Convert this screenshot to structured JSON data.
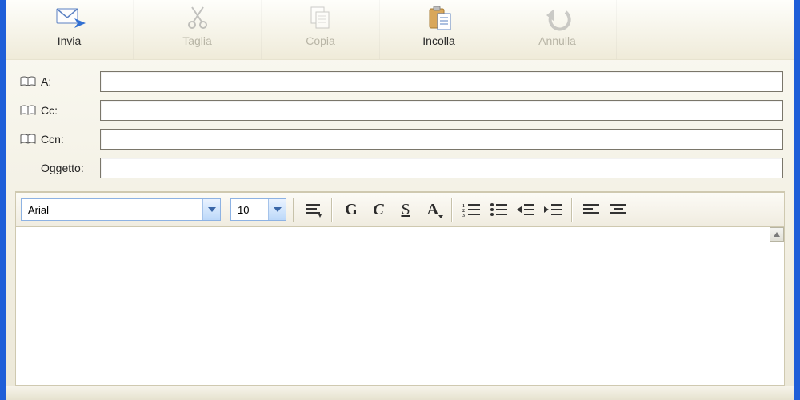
{
  "toolbar": {
    "items": [
      {
        "id": "send",
        "label": "Invia",
        "enabled": true
      },
      {
        "id": "cut",
        "label": "Taglia",
        "enabled": false
      },
      {
        "id": "copy",
        "label": "Copia",
        "enabled": false
      },
      {
        "id": "paste",
        "label": "Incolla",
        "enabled": true
      },
      {
        "id": "undo",
        "label": "Annulla",
        "enabled": false
      }
    ]
  },
  "fields": {
    "to": {
      "label": "A:",
      "value": ""
    },
    "cc": {
      "label": "Cc:",
      "value": ""
    },
    "bcc": {
      "label": "Ccn:",
      "value": ""
    },
    "subject": {
      "label": "Oggetto:",
      "value": ""
    }
  },
  "format": {
    "font_name": "Arial",
    "font_size": "10",
    "buttons": {
      "paragraph_style": "paragraph-style",
      "bold": "G",
      "italic": "C",
      "underline": "S",
      "font_color": "A",
      "list_number": "numbered-list-icon",
      "list_bullet": "bulleted-list-icon",
      "outdent": "outdent-icon",
      "indent": "indent-icon",
      "align_left": "align-left-icon",
      "align_center": "align-center-icon"
    }
  },
  "colors": {
    "window_frame": "#1e5ed8",
    "panel_bg_top": "#fdfcf6",
    "panel_bg_bottom": "#ece8d8",
    "input_border": "#7a766a",
    "combo_border": "#8db2e3",
    "combo_btn_bg": "#bcd8f9",
    "disabled_text": "#b8b5a6"
  }
}
